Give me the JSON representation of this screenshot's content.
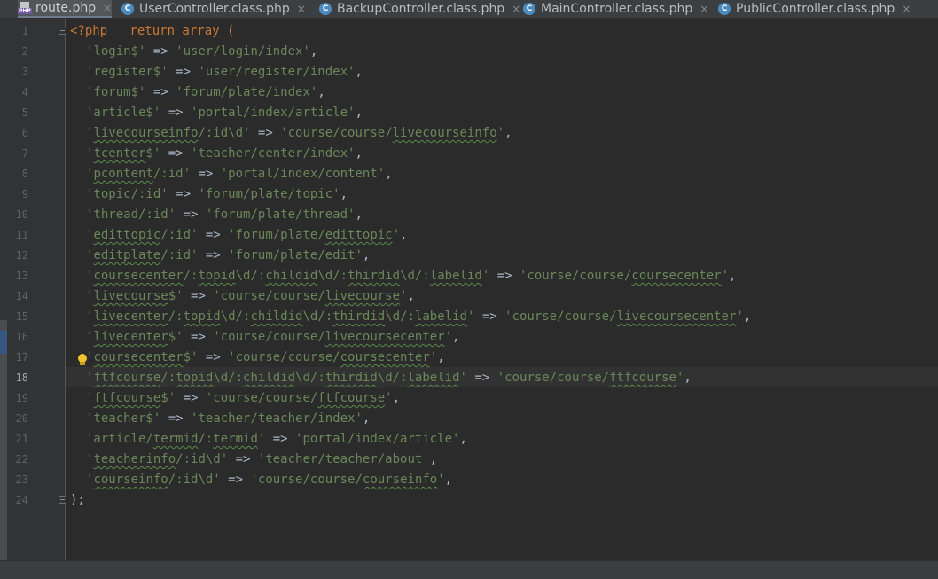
{
  "tabs": [
    {
      "label": "route.php",
      "icon": "php-file-icon",
      "active": true
    },
    {
      "label": "UserController.class.php",
      "icon": "class-c-icon"
    },
    {
      "label": "BackupController.class.php",
      "icon": "class-c-icon"
    },
    {
      "label": "MainController.class.php",
      "icon": "class-c-icon"
    },
    {
      "label": "PublicController.class.php",
      "icon": "class-c-icon"
    }
  ],
  "tab_close_glyph": "×",
  "editor": {
    "current_line": 18,
    "line_numbers": [
      "1",
      "2",
      "3",
      "4",
      "5",
      "6",
      "7",
      "8",
      "9",
      "10",
      "11",
      "12",
      "13",
      "14",
      "15",
      "16",
      "17",
      "18",
      "19",
      "20",
      "21",
      "22",
      "23",
      "24"
    ]
  },
  "code": [
    [
      [
        "kw",
        "<?php   return array ("
      ]
    ],
    [
      [
        "str",
        "'login$'"
      ],
      [
        "op",
        " => "
      ],
      [
        "str",
        "'user/login/index'"
      ],
      [
        "op",
        ","
      ]
    ],
    [
      [
        "str",
        "'register$'"
      ],
      [
        "op",
        " => "
      ],
      [
        "str",
        "'user/register/index'"
      ],
      [
        "op",
        ","
      ]
    ],
    [
      [
        "str",
        "'forum$'"
      ],
      [
        "op",
        " => "
      ],
      [
        "str",
        "'forum/plate/index'"
      ],
      [
        "op",
        ","
      ]
    ],
    [
      [
        "str",
        "'article$'"
      ],
      [
        "op",
        " => "
      ],
      [
        "str",
        "'portal/index/article'"
      ],
      [
        "op",
        ","
      ]
    ],
    [
      [
        "str",
        "'"
      ],
      [
        "sq",
        "livecourseinfo"
      ],
      [
        "str",
        "/:id\\d'"
      ],
      [
        "op",
        " => "
      ],
      [
        "str",
        "'course/course/"
      ],
      [
        "sq",
        "livecourseinfo"
      ],
      [
        "str",
        "'"
      ],
      [
        "op",
        ","
      ]
    ],
    [
      [
        "str",
        "'"
      ],
      [
        "sq",
        "tcenter"
      ],
      [
        "str",
        "$'"
      ],
      [
        "op",
        " => "
      ],
      [
        "str",
        "'teacher/center/index'"
      ],
      [
        "op",
        ","
      ]
    ],
    [
      [
        "str",
        "'"
      ],
      [
        "sq",
        "pcontent"
      ],
      [
        "str",
        "/:id'"
      ],
      [
        "op",
        " => "
      ],
      [
        "str",
        "'portal/index/content'"
      ],
      [
        "op",
        ","
      ]
    ],
    [
      [
        "str",
        "'topic/:id'"
      ],
      [
        "op",
        " => "
      ],
      [
        "str",
        "'forum/plate/topic'"
      ],
      [
        "op",
        ","
      ]
    ],
    [
      [
        "str",
        "'thread/:id'"
      ],
      [
        "op",
        " => "
      ],
      [
        "str",
        "'forum/plate/thread'"
      ],
      [
        "op",
        ","
      ]
    ],
    [
      [
        "str",
        "'"
      ],
      [
        "sq",
        "edittopic"
      ],
      [
        "str",
        "/:id'"
      ],
      [
        "op",
        " => "
      ],
      [
        "str",
        "'forum/plate/"
      ],
      [
        "sq",
        "edittopic"
      ],
      [
        "str",
        "'"
      ],
      [
        "op",
        ","
      ]
    ],
    [
      [
        "str",
        "'"
      ],
      [
        "sq",
        "editplate"
      ],
      [
        "str",
        "/:id'"
      ],
      [
        "op",
        " => "
      ],
      [
        "str",
        "'forum/plate/edit'"
      ],
      [
        "op",
        ","
      ]
    ],
    [
      [
        "str",
        "'"
      ],
      [
        "sq",
        "coursecenter"
      ],
      [
        "str",
        "/:"
      ],
      [
        "sq",
        "topid"
      ],
      [
        "str",
        "\\d/:"
      ],
      [
        "sq",
        "childid"
      ],
      [
        "str",
        "\\d/:"
      ],
      [
        "sq",
        "thirdid"
      ],
      [
        "str",
        "\\d/:"
      ],
      [
        "sq",
        "labelid"
      ],
      [
        "str",
        "'"
      ],
      [
        "op",
        " => "
      ],
      [
        "str",
        "'course/course/"
      ],
      [
        "sq",
        "coursecenter"
      ],
      [
        "str",
        "'"
      ],
      [
        "op",
        ","
      ]
    ],
    [
      [
        "str",
        "'"
      ],
      [
        "sq",
        "livecourse"
      ],
      [
        "str",
        "$'"
      ],
      [
        "op",
        " => "
      ],
      [
        "str",
        "'course/course/"
      ],
      [
        "sq",
        "livecourse"
      ],
      [
        "str",
        "'"
      ],
      [
        "op",
        ","
      ]
    ],
    [
      [
        "str",
        "'"
      ],
      [
        "sq",
        "livecenter"
      ],
      [
        "str",
        "/:"
      ],
      [
        "sq",
        "topid"
      ],
      [
        "str",
        "\\d/:"
      ],
      [
        "sq",
        "childid"
      ],
      [
        "str",
        "\\d/:"
      ],
      [
        "sq",
        "thirdid"
      ],
      [
        "str",
        "\\d/:"
      ],
      [
        "sq",
        "labelid"
      ],
      [
        "str",
        "'"
      ],
      [
        "op",
        " => "
      ],
      [
        "str",
        "'course/course/"
      ],
      [
        "sq",
        "livecoursecenter"
      ],
      [
        "str",
        "'"
      ],
      [
        "op",
        ","
      ]
    ],
    [
      [
        "str",
        "'"
      ],
      [
        "sq",
        "livecenter"
      ],
      [
        "str",
        "$'"
      ],
      [
        "op",
        " => "
      ],
      [
        "str",
        "'course/course/"
      ],
      [
        "sq",
        "livecoursecenter"
      ],
      [
        "str",
        "'"
      ],
      [
        "op",
        ","
      ]
    ],
    [
      [
        "str",
        "'"
      ],
      [
        "sq",
        "coursecenter"
      ],
      [
        "str",
        "$'"
      ],
      [
        "op",
        " => "
      ],
      [
        "str",
        "'course/course/"
      ],
      [
        "sq",
        "coursecenter"
      ],
      [
        "str",
        "'"
      ],
      [
        "op",
        ","
      ]
    ],
    [
      [
        "str",
        "'"
      ],
      [
        "sq",
        "ftfcourse"
      ],
      [
        "str",
        "/:"
      ],
      [
        "sq",
        "topid"
      ],
      [
        "str",
        "\\d/:"
      ],
      [
        "sq",
        "childid"
      ],
      [
        "str",
        "\\d/:"
      ],
      [
        "sq",
        "thirdid"
      ],
      [
        "str",
        "\\d/:"
      ],
      [
        "sq",
        "labelid"
      ],
      [
        "str",
        "'"
      ],
      [
        "op",
        " => "
      ],
      [
        "str",
        "'course/course/"
      ],
      [
        "sq",
        "ftfcourse"
      ],
      [
        "str",
        "'"
      ],
      [
        "op",
        ","
      ]
    ],
    [
      [
        "str",
        "'"
      ],
      [
        "sq",
        "ftfcourse"
      ],
      [
        "str",
        "$'"
      ],
      [
        "op",
        " => "
      ],
      [
        "str",
        "'course/course/"
      ],
      [
        "sq",
        "ftfcourse"
      ],
      [
        "str",
        "'"
      ],
      [
        "op",
        ","
      ]
    ],
    [
      [
        "str",
        "'teacher$'"
      ],
      [
        "op",
        " => "
      ],
      [
        "str",
        "'teacher/teacher/index'"
      ],
      [
        "op",
        ","
      ]
    ],
    [
      [
        "str",
        "'article/"
      ],
      [
        "sq",
        "termid"
      ],
      [
        "str",
        "/:"
      ],
      [
        "sq",
        "termid"
      ],
      [
        "str",
        "'"
      ],
      [
        "op",
        " => "
      ],
      [
        "str",
        "'portal/index/article'"
      ],
      [
        "op",
        ","
      ]
    ],
    [
      [
        "str",
        "'"
      ],
      [
        "sq",
        "teacherinfo"
      ],
      [
        "str",
        "/:id\\d'"
      ],
      [
        "op",
        " => "
      ],
      [
        "str",
        "'teacher/teacher/about'"
      ],
      [
        "op",
        ","
      ]
    ],
    [
      [
        "str",
        "'"
      ],
      [
        "sq",
        "courseinfo"
      ],
      [
        "str",
        "/:id\\d'"
      ],
      [
        "op",
        " => "
      ],
      [
        "str",
        "'course/course/"
      ],
      [
        "sq",
        "courseinfo"
      ],
      [
        "str",
        "'"
      ],
      [
        "op",
        ","
      ]
    ],
    [
      [
        "op",
        ");"
      ]
    ]
  ]
}
